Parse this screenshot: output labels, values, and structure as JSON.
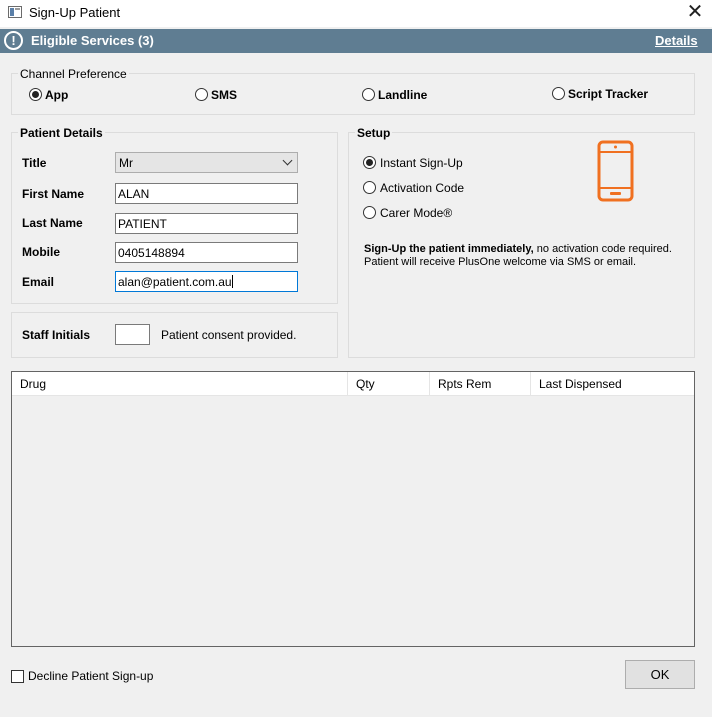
{
  "window": {
    "title": "Sign-Up Patient",
    "close_glyph": "✕"
  },
  "banner": {
    "icon_glyph": "!",
    "title": "Eligible Services (3)",
    "details_link": "Details"
  },
  "channel": {
    "legend": "Channel Preference",
    "options": [
      {
        "label": "App",
        "checked": true
      },
      {
        "label": "SMS",
        "checked": false
      },
      {
        "label": "Landline",
        "checked": false
      },
      {
        "label": "Script Tracker",
        "checked": false
      }
    ]
  },
  "patient": {
    "legend": "Patient Details",
    "title_label": "Title",
    "title_value": "Mr",
    "first_name_label": "First Name",
    "first_name_value": "ALAN",
    "last_name_label": "Last Name",
    "last_name_value": "PATIENT",
    "mobile_label": "Mobile",
    "mobile_value": "0405148894",
    "email_label": "Email",
    "email_value": "alan@patient.com.au"
  },
  "staff": {
    "initials_label": "Staff Initials",
    "initials_value": "",
    "consent_text": "Patient consent provided."
  },
  "setup": {
    "legend": "Setup",
    "options": [
      {
        "label": "Instant Sign-Up",
        "checked": true
      },
      {
        "label": "Activation Code",
        "checked": false
      },
      {
        "label": "Carer Mode®",
        "checked": false
      }
    ],
    "desc_bold": "Sign-Up the patient immediately,",
    "desc_rest": " no activation code required.",
    "desc_line2": "Patient will receive PlusOne welcome via SMS or email.",
    "phone_icon": "mobile-phone-icon",
    "accent_color": "#f07020"
  },
  "drug_table": {
    "columns": [
      "Drug",
      "Qty",
      "Rpts Rem",
      "Last Dispensed"
    ],
    "rows": []
  },
  "footer": {
    "decline_label": "Decline Patient Sign-up",
    "ok_label": "OK"
  },
  "colors": {
    "banner_bg": "#5f7d92",
    "focus_border": "#0078d7"
  }
}
